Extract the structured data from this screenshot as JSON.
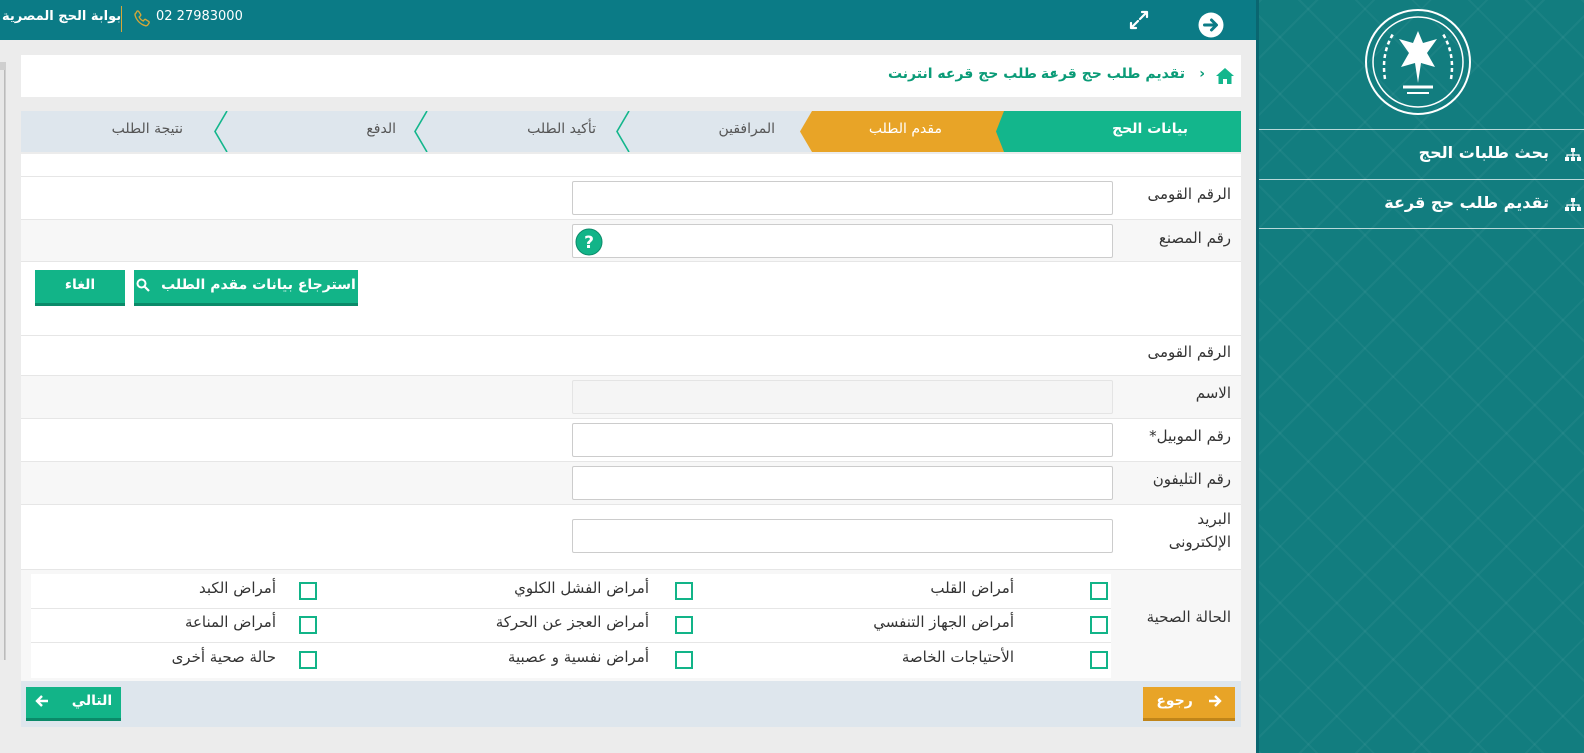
{
  "topbar": {
    "portal_title": "بوابة الحج المصرية",
    "phone": "02 27983000",
    "icons": [
      "phone-icon",
      "expand-icon",
      "arrow-right-circle-icon"
    ]
  },
  "sidebar": {
    "items": [
      {
        "label": "بحث طلبات الحج",
        "icon": "sitemap-icon"
      },
      {
        "label": "تقديم طلب حج قرعة",
        "icon": "sitemap-icon"
      }
    ]
  },
  "breadcrumb": {
    "items": [
      "تقديم طلب حج قرعة",
      "طلب حج قرعه انترنت"
    ]
  },
  "wizard": {
    "steps": [
      "بيانات الحج",
      "مقدم الطلب",
      "المرافقين",
      "تأكيد الطلب",
      "الدفع",
      "نتيجة الطلب"
    ],
    "active_index": 1,
    "colors": {
      "done": "#13b68c",
      "active": "#e8a427",
      "pending": "#dee6ed"
    }
  },
  "lookup": {
    "national_id_label": "الرقم القومى",
    "factory_no_label": "رقم المصنع",
    "retrieve_label": "استرجاع بيانات مقدم الطلب",
    "cancel_label": "الغاء"
  },
  "applicant": {
    "national_id_label": "الرقم القومى",
    "name_label": "الاسم",
    "mobile_label": "رقم الموبيل*",
    "phone_label": "رقم التليفون",
    "email_label_1": "البريد",
    "email_label_2": "الإلكترونى",
    "health_label": "الحالة الصحية",
    "health_options": [
      "أمراض القلب",
      "أمراض الفشل الكلوي",
      "أمراض الكبد",
      "أمراض الجهاز التنفسي",
      "أمراض العجز عن الحركة",
      "أمراض المناعة",
      "الأحتياجات الخاصة",
      "أمراض نفسية و عصبية",
      "حالة صحية أخرى"
    ]
  },
  "nav": {
    "back_label": "رجوع",
    "next_label": "التالي"
  }
}
